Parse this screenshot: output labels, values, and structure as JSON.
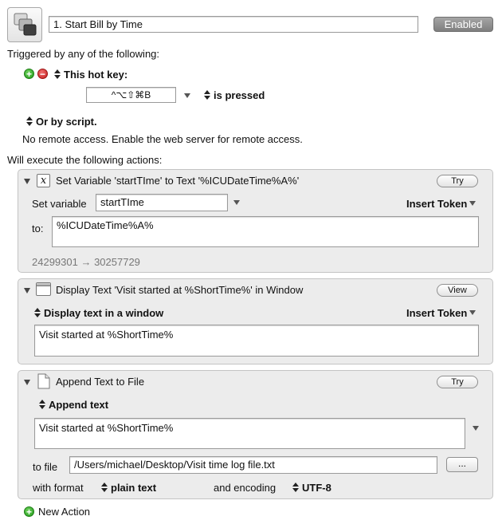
{
  "header": {
    "macro_name": "1. Start Bill by Time",
    "enabled_label": "Enabled"
  },
  "triggers": {
    "heading": "Triggered by any of the following:",
    "hotkey_label": "This hot key:",
    "hotkey_value": "^⌥⇧⌘B",
    "pressed_label": "is pressed",
    "script_label": "Or by script.",
    "remote_text": "No remote access.  Enable the web server for remote access."
  },
  "actions_heading": "Will execute the following actions:",
  "actions": [
    {
      "title": "Set Variable 'startTIme' to Text '%ICUDateTime%A%'",
      "button": "Try",
      "set_variable_label": "Set variable",
      "variable_value": "startTIme",
      "insert_token_label": "Insert Token",
      "to_label": "to:",
      "text_value": "%ICUDateTime%A%",
      "footer": "24299301 → 30257729"
    },
    {
      "title": "Display Text 'Visit started at %ShortTime%' in Window",
      "button": "View",
      "mode_label": "Display text in a window",
      "insert_token_label": "Insert Token",
      "text_value": "Visit started at %ShortTime%"
    },
    {
      "title": "Append Text to File",
      "button": "Try",
      "mode_label": "Append text",
      "text_value": "Visit started at %ShortTime%",
      "to_file_label": "to file",
      "file_path": "/Users/michael/Desktop/Visit time log file.txt",
      "browse_label": "...",
      "with_format_label": "with format",
      "format_value": "plain text",
      "encoding_label": "and encoding",
      "encoding_value": "UTF-8"
    }
  ],
  "new_action_label": "New Action",
  "icons": {
    "macro": "macro-windows-icon",
    "add": "plus-icon",
    "remove": "minus-icon",
    "variable": "variable-x-icon",
    "window": "window-icon",
    "document": "document-icon"
  },
  "colors": {
    "enabled_button": "#8a8a8a",
    "add_green": "#229a1a",
    "remove_red": "#c41c1c"
  }
}
